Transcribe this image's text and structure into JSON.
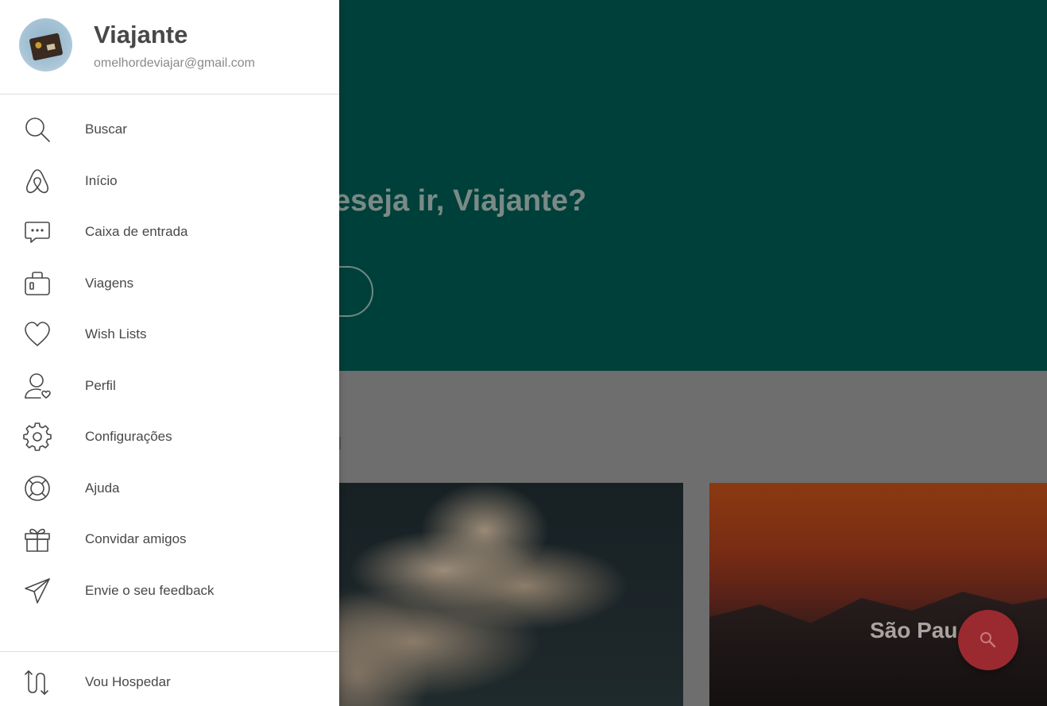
{
  "background": {
    "hero_title": "eseja ir, Viajante?",
    "card_city_title": "São Pau"
  },
  "drawer": {
    "user": {
      "name": "Viajante",
      "email": "omelhordeviajar@gmail.com"
    },
    "menu": [
      {
        "label": "Buscar",
        "icon": "search-icon"
      },
      {
        "label": "Início",
        "icon": "airbnb-logo-icon"
      },
      {
        "label": "Caixa de entrada",
        "icon": "message-bubble-icon"
      },
      {
        "label": "Viagens",
        "icon": "suitcase-icon"
      },
      {
        "label": "Wish Lists",
        "icon": "heart-icon"
      },
      {
        "label": "Perfil",
        "icon": "profile-icon"
      },
      {
        "label": "Configurações",
        "icon": "gear-icon"
      },
      {
        "label": "Ajuda",
        "icon": "lifebuoy-icon"
      },
      {
        "label": "Convidar amigos",
        "icon": "gift-icon"
      },
      {
        "label": "Envie o seu feedback",
        "icon": "paper-plane-icon"
      }
    ],
    "footer": {
      "label": "Vou Hospedar",
      "icon": "switch-arrows-icon"
    }
  },
  "colors": {
    "hero_bg": "#00403a",
    "fab": "#9a2a30",
    "text": "#484848"
  }
}
